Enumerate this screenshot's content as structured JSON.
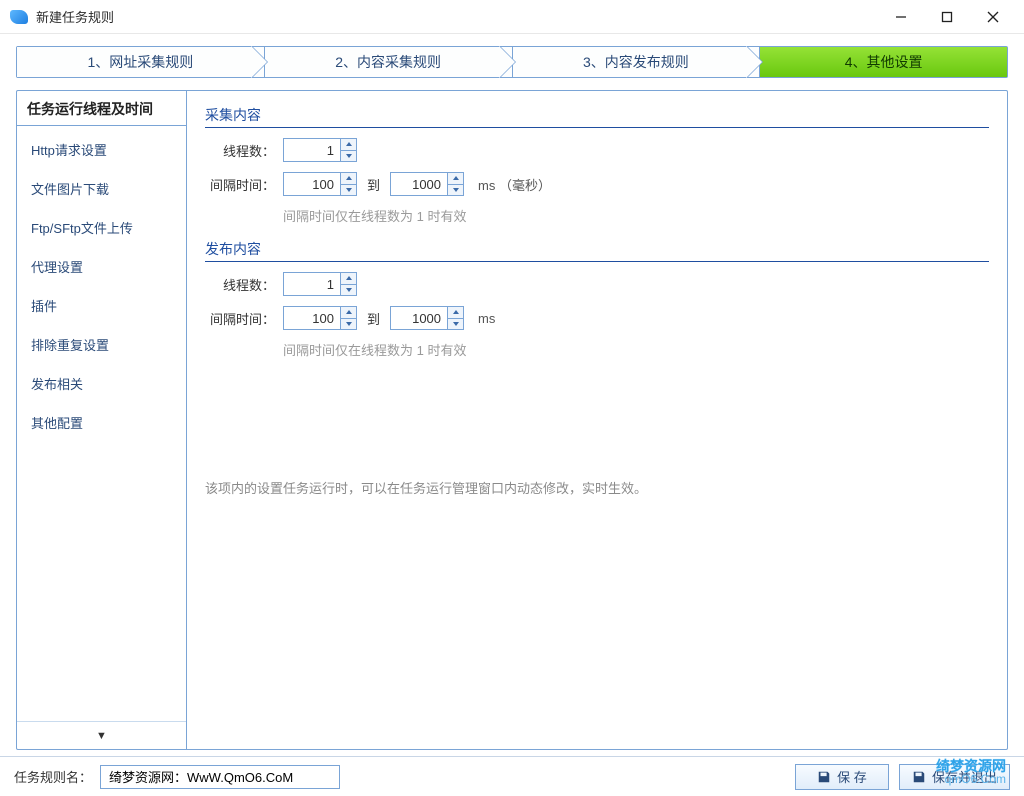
{
  "window": {
    "title": "新建任务规则"
  },
  "steps": {
    "s1": "1、网址采集规则",
    "s2": "2、内容采集规则",
    "s3": "3、内容发布规则",
    "s4": "4、其他设置"
  },
  "sidebar": {
    "header": "任务运行线程及时间",
    "items": {
      "i0": "Http请求设置",
      "i1": "文件图片下载",
      "i2": "Ftp/SFtp文件上传",
      "i3": "代理设置",
      "i4": "插件",
      "i5": "排除重复设置",
      "i6": "发布相关",
      "i7": "其他配置"
    }
  },
  "content": {
    "collect": {
      "title": "采集内容",
      "threads_label": "线程数：",
      "threads_value": "1",
      "interval_label": "间隔时间：",
      "interval_from": "100",
      "to_text": "到",
      "interval_to": "1000",
      "unit": "ms （毫秒）",
      "hint": "间隔时间仅在线程数为 1 时有效"
    },
    "publish": {
      "title": "发布内容",
      "threads_label": "线程数：",
      "threads_value": "1",
      "interval_label": "间隔时间：",
      "interval_from": "100",
      "to_text": "到",
      "interval_to": "1000",
      "unit": "ms",
      "hint": "间隔时间仅在线程数为 1 时有效"
    },
    "note": "该项内的设置任务运行时，可以在任务运行管理窗口内动态修改，实时生效。"
  },
  "footer": {
    "label": "任务规则名：",
    "rulename": "绮梦资源网：WwW.QmO6.CoM",
    "save": "保 存",
    "save_exit": "保存并退出"
  },
  "watermark": {
    "l1": "绮梦资源网",
    "l2": "qmO6.Com"
  }
}
